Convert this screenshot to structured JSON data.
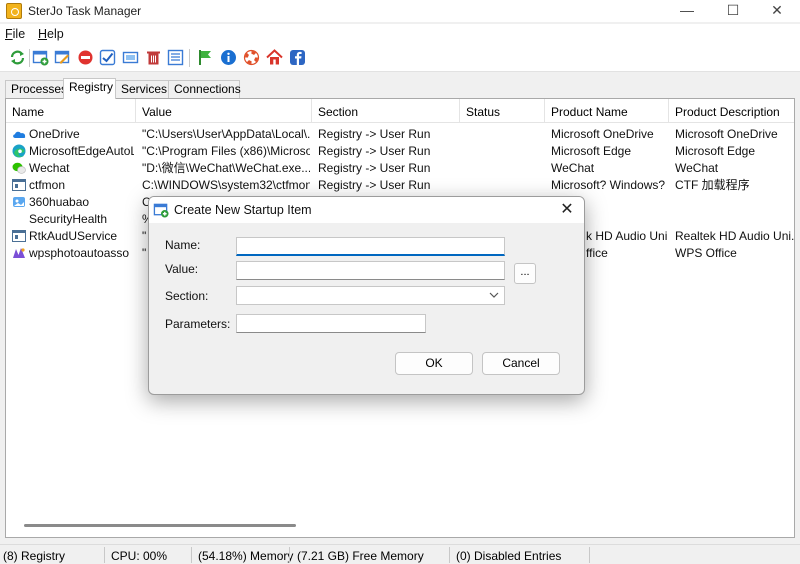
{
  "window": {
    "title": "SterJo Task Manager"
  },
  "menu": {
    "file": "File",
    "help": "Help"
  },
  "toolbar": {
    "icons": [
      "refresh-icon",
      "add-item-icon",
      "edit-item-icon",
      "disable-item-icon",
      "enable-check-icon",
      "open-location-icon",
      "delete-icon",
      "properties-icon",
      "flag-icon",
      "info-icon",
      "help-lifebuoy-icon",
      "home-icon",
      "facebook-icon"
    ]
  },
  "tabs": [
    "Processes",
    "Registry",
    "Services",
    "Connections"
  ],
  "active_tab": "Registry",
  "columns": [
    "Name",
    "Value",
    "Section",
    "Status",
    "Product Name",
    "Product Description"
  ],
  "rows": [
    {
      "name": "OneDrive",
      "value": "\"C:\\Users\\User\\AppData\\Local\\...",
      "section": "Registry -> User Run",
      "status": "",
      "product": "Microsoft OneDrive",
      "desc": "Microsoft OneDrive",
      "icon": "onedrive-icon"
    },
    {
      "name": "MicrosoftEdgeAutoL...",
      "value": "\"C:\\Program Files (x86)\\Microsoft...",
      "section": "Registry -> User Run",
      "status": "",
      "product": "Microsoft Edge",
      "desc": "Microsoft Edge",
      "icon": "edge-icon"
    },
    {
      "name": "Wechat",
      "value": "\"D:\\微信\\WeChat\\WeChat.exe...",
      "section": "Registry -> User Run",
      "status": "",
      "product": "WeChat",
      "desc": "WeChat",
      "icon": "wechat-icon"
    },
    {
      "name": "ctfmon",
      "value": "C:\\WINDOWS\\system32\\ctfmon...",
      "section": "Registry -> User Run",
      "status": "",
      "product": "Microsoft? Windows? ...",
      "desc": "CTF 加载程序",
      "icon": "window-app-icon"
    },
    {
      "name": "360huabao",
      "value": "C",
      "section": "",
      "status": "",
      "product": "",
      "desc": "",
      "icon": "360-icon"
    },
    {
      "name": "SecurityHealth",
      "value": "%",
      "section": "",
      "status": "",
      "product": "",
      "desc": "",
      "icon": ""
    },
    {
      "name": "RtkAudUService",
      "value": "\"",
      "section": "",
      "status": "",
      "product": "k HD Audio Uni...",
      "desc": "Realtek HD Audio Uni...",
      "icon": "window-app-icon"
    },
    {
      "name": "wpsphotoautoasso",
      "value": "\"",
      "section": "",
      "status": "",
      "product": "ffice",
      "desc": "WPS Office",
      "icon": "wps-icon"
    }
  ],
  "status": {
    "registry": "(8) Registry",
    "cpu": "CPU: 00%",
    "memory": "(54.18%) Memory",
    "free_memory": "(7.21 GB) Free Memory",
    "disabled": "(0) Disabled Entries"
  },
  "dialog": {
    "title": "Create New Startup Item",
    "name_label": "Name:",
    "value_label": "Value:",
    "section_label": "Section:",
    "parameters_label": "Parameters:",
    "name_value": "",
    "value_value": "",
    "section_value": "",
    "parameters_value": "",
    "browse_label": "...",
    "ok_label": "OK",
    "cancel_label": "Cancel"
  },
  "colors": {
    "accent": "#0067c0",
    "dialog_bg": "#f0f0f0"
  }
}
